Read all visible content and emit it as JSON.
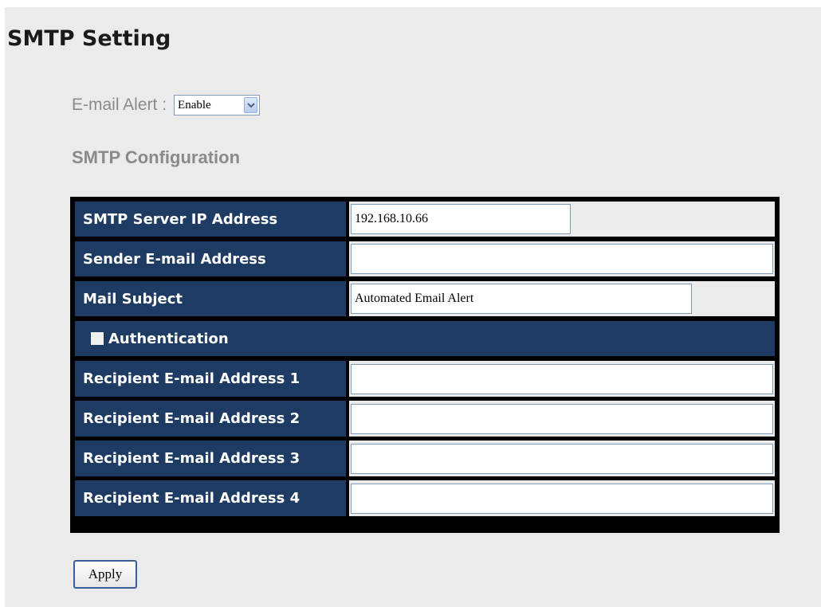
{
  "page": {
    "title": "SMTP Setting"
  },
  "email_alert": {
    "label": "E-mail Alert :",
    "selected": "Enable",
    "arrow_icon": "chevron-down-icon"
  },
  "smtp": {
    "section_title": "SMTP Configuration",
    "server_ip": {
      "label": "SMTP Server IP Address",
      "value": "192.168.10.66"
    },
    "sender": {
      "label": "Sender E-mail Address",
      "value": ""
    },
    "subject": {
      "label": "Mail Subject",
      "value": "Automated Email Alert"
    },
    "authentication": {
      "label": "Authentication",
      "checked": false
    },
    "recipients": [
      {
        "label": "Recipient E-mail Address 1",
        "value": ""
      },
      {
        "label": "Recipient E-mail Address 2",
        "value": ""
      },
      {
        "label": "Recipient E-mail Address 3",
        "value": ""
      },
      {
        "label": "Recipient E-mail Address 4",
        "value": ""
      }
    ]
  },
  "actions": {
    "apply_label": "Apply"
  },
  "colors": {
    "label_bg": "#1e3b63",
    "table_border": "#000000",
    "page_bg": "#ebebeb",
    "muted_text": "#8a8a8a"
  }
}
